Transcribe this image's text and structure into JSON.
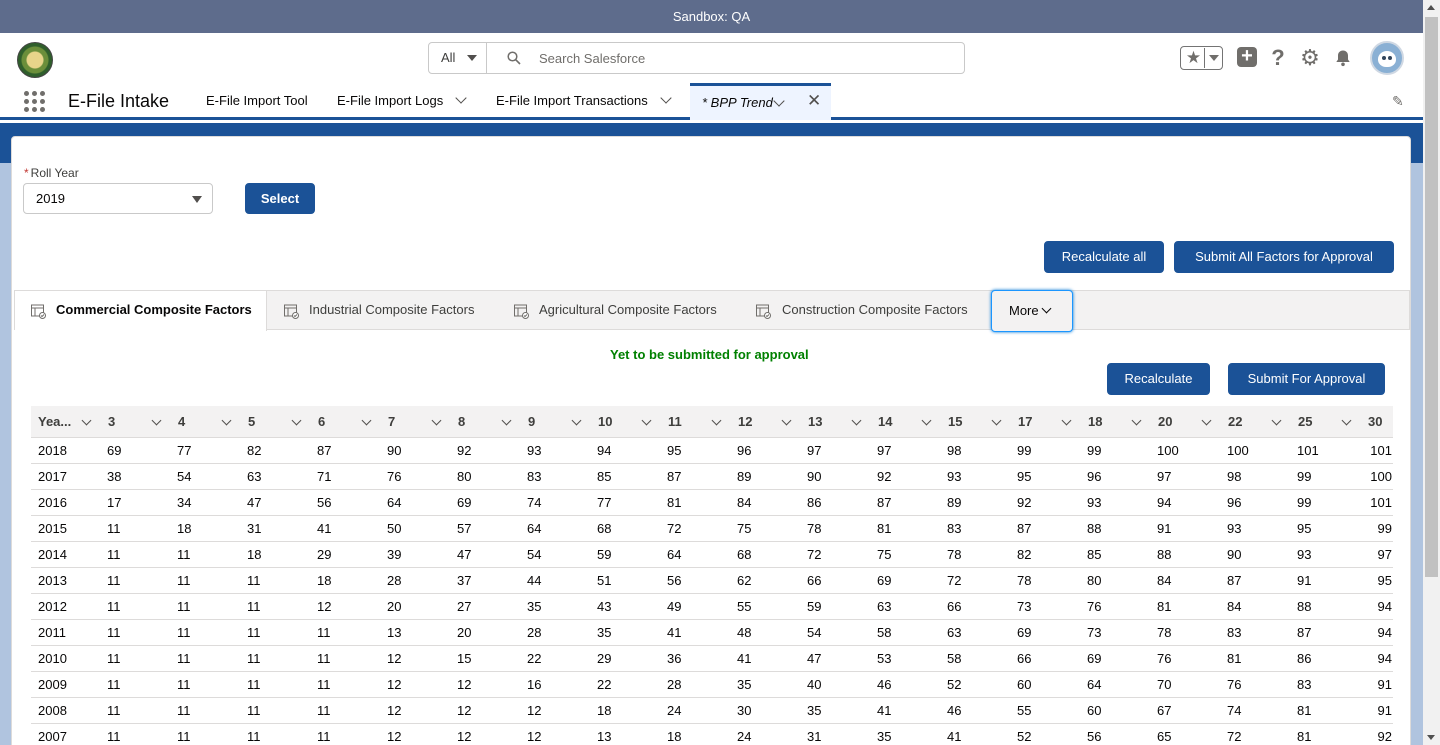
{
  "sandbox": {
    "label": "Sandbox: QA"
  },
  "header": {
    "search_scope": "All",
    "search_placeholder": "Search Salesforce",
    "icons": [
      "favorites-star-icon",
      "plus-icon",
      "help-icon",
      "gear-icon",
      "bell-icon",
      "avatar"
    ]
  },
  "nav": {
    "app_name": "E-File Intake",
    "items": [
      {
        "label": "E-File Import Tool"
      },
      {
        "label": "E-File Import Logs"
      },
      {
        "label": "E-File Import Transactions"
      }
    ],
    "active_tab": "* BPP Trend"
  },
  "form": {
    "roll_year_label": "Roll Year",
    "required_mark": "*",
    "roll_year_value": "2019",
    "select_button": "Select",
    "recalculate_all_button": "Recalculate all",
    "submit_all_button": "Submit All Factors for Approval"
  },
  "tabs": {
    "items": [
      {
        "label": "Commercial Composite Factors"
      },
      {
        "label": "Industrial Composite Factors"
      },
      {
        "label": "Agricultural Composite Factors"
      },
      {
        "label": "Construction Composite Factors"
      }
    ],
    "more": "More"
  },
  "status_text": "Yet to be submitted for approval",
  "actions": {
    "recalculate": "Recalculate",
    "submit_for_approval": "Submit For Approval"
  },
  "table": {
    "headers": [
      "Yea...",
      "3",
      "4",
      "5",
      "6",
      "7",
      "8",
      "9",
      "10",
      "11",
      "12",
      "13",
      "14",
      "15",
      "17",
      "18",
      "20",
      "22",
      "25",
      "30"
    ],
    "rows": [
      [
        "2018",
        "69",
        "77",
        "82",
        "87",
        "90",
        "92",
        "93",
        "94",
        "95",
        "96",
        "97",
        "97",
        "98",
        "99",
        "99",
        "100",
        "100",
        "101",
        "101"
      ],
      [
        "2017",
        "38",
        "54",
        "63",
        "71",
        "76",
        "80",
        "83",
        "85",
        "87",
        "89",
        "90",
        "92",
        "93",
        "95",
        "96",
        "97",
        "98",
        "99",
        "100"
      ],
      [
        "2016",
        "17",
        "34",
        "47",
        "56",
        "64",
        "69",
        "74",
        "77",
        "81",
        "84",
        "86",
        "87",
        "89",
        "92",
        "93",
        "94",
        "96",
        "99",
        "101"
      ],
      [
        "2015",
        "11",
        "18",
        "31",
        "41",
        "50",
        "57",
        "64",
        "68",
        "72",
        "75",
        "78",
        "81",
        "83",
        "87",
        "88",
        "91",
        "93",
        "95",
        "99"
      ],
      [
        "2014",
        "11",
        "11",
        "18",
        "29",
        "39",
        "47",
        "54",
        "59",
        "64",
        "68",
        "72",
        "75",
        "78",
        "82",
        "85",
        "88",
        "90",
        "93",
        "97"
      ],
      [
        "2013",
        "11",
        "11",
        "11",
        "18",
        "28",
        "37",
        "44",
        "51",
        "56",
        "62",
        "66",
        "69",
        "72",
        "78",
        "80",
        "84",
        "87",
        "91",
        "95"
      ],
      [
        "2012",
        "11",
        "11",
        "11",
        "12",
        "20",
        "27",
        "35",
        "43",
        "49",
        "55",
        "59",
        "63",
        "66",
        "73",
        "76",
        "81",
        "84",
        "88",
        "94"
      ],
      [
        "2011",
        "11",
        "11",
        "11",
        "11",
        "13",
        "20",
        "28",
        "35",
        "41",
        "48",
        "54",
        "58",
        "63",
        "69",
        "73",
        "78",
        "83",
        "87",
        "94"
      ],
      [
        "2010",
        "11",
        "11",
        "11",
        "11",
        "12",
        "15",
        "22",
        "29",
        "36",
        "41",
        "47",
        "53",
        "58",
        "66",
        "69",
        "76",
        "81",
        "86",
        "94"
      ],
      [
        "2009",
        "11",
        "11",
        "11",
        "11",
        "12",
        "12",
        "16",
        "22",
        "28",
        "35",
        "40",
        "46",
        "52",
        "60",
        "64",
        "70",
        "76",
        "83",
        "91"
      ],
      [
        "2008",
        "11",
        "11",
        "11",
        "11",
        "12",
        "12",
        "12",
        "18",
        "24",
        "30",
        "35",
        "41",
        "46",
        "55",
        "60",
        "67",
        "74",
        "81",
        "91"
      ],
      [
        "2007",
        "11",
        "11",
        "11",
        "11",
        "12",
        "12",
        "12",
        "13",
        "18",
        "24",
        "31",
        "35",
        "41",
        "52",
        "56",
        "65",
        "72",
        "81",
        "92"
      ]
    ]
  }
}
